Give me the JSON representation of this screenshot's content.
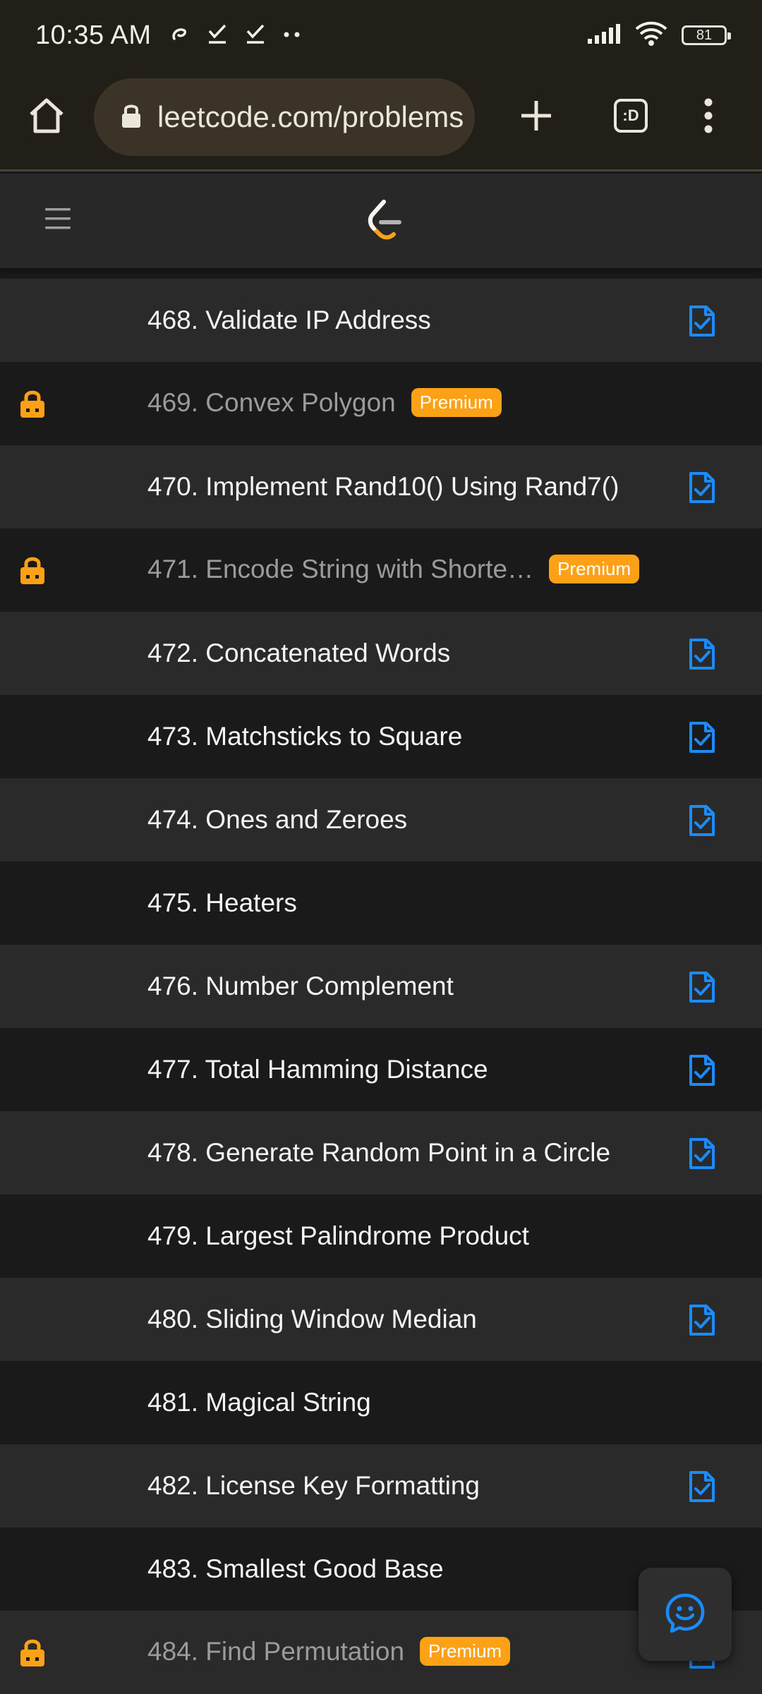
{
  "status_bar": {
    "time": "10:35 AM",
    "left_icons": [
      "swirl-icon",
      "check-download-icon",
      "check-download-icon",
      "more-dots-icon"
    ],
    "battery": "81",
    "right_icons": [
      "signal-icon",
      "wifi-icon",
      "battery-icon"
    ]
  },
  "browser": {
    "url": "leetcode.com/problems",
    "tab_switcher_label": ":D",
    "icons": [
      "home-icon",
      "lock-icon",
      "plus-icon",
      "tab-switcher-icon",
      "more-vert-icon"
    ]
  },
  "header": {
    "icons": [
      "menu-icon",
      "leetcode-logo"
    ]
  },
  "problems": [
    {
      "title": "468. Validate IP Address",
      "premium": false,
      "solved": true
    },
    {
      "title": "469. Convex Polygon",
      "premium": true,
      "solved": false
    },
    {
      "title": "470. Implement Rand10() Using Rand7()",
      "premium": false,
      "solved": true
    },
    {
      "title": "471. Encode String with Shorte…",
      "premium": true,
      "solved": false
    },
    {
      "title": "472. Concatenated Words",
      "premium": false,
      "solved": true
    },
    {
      "title": "473. Matchsticks to Square",
      "premium": false,
      "solved": true
    },
    {
      "title": "474. Ones and Zeroes",
      "premium": false,
      "solved": true
    },
    {
      "title": "475. Heaters",
      "premium": false,
      "solved": false
    },
    {
      "title": "476. Number Complement",
      "premium": false,
      "solved": true
    },
    {
      "title": "477. Total Hamming Distance",
      "premium": false,
      "solved": true
    },
    {
      "title": "478. Generate Random Point in a Circle",
      "premium": false,
      "solved": true
    },
    {
      "title": "479. Largest Palindrome Product",
      "premium": false,
      "solved": false
    },
    {
      "title": "480. Sliding Window Median",
      "premium": false,
      "solved": true
    },
    {
      "title": "481. Magical String",
      "premium": false,
      "solved": false
    },
    {
      "title": "482. License Key Formatting",
      "premium": false,
      "solved": true
    },
    {
      "title": "483. Smallest Good Base",
      "premium": false,
      "solved": false
    },
    {
      "title": "484. Find Permutation",
      "premium": true,
      "solved": true
    }
  ],
  "premium_label": "Premium",
  "colors": {
    "accent_orange": "#ffa116",
    "solved_blue": "#1a8cff",
    "row_alt": "#2a2a2a",
    "row_base": "#1a1a1a"
  },
  "fab": {
    "icon": "feedback-smile-icon"
  }
}
